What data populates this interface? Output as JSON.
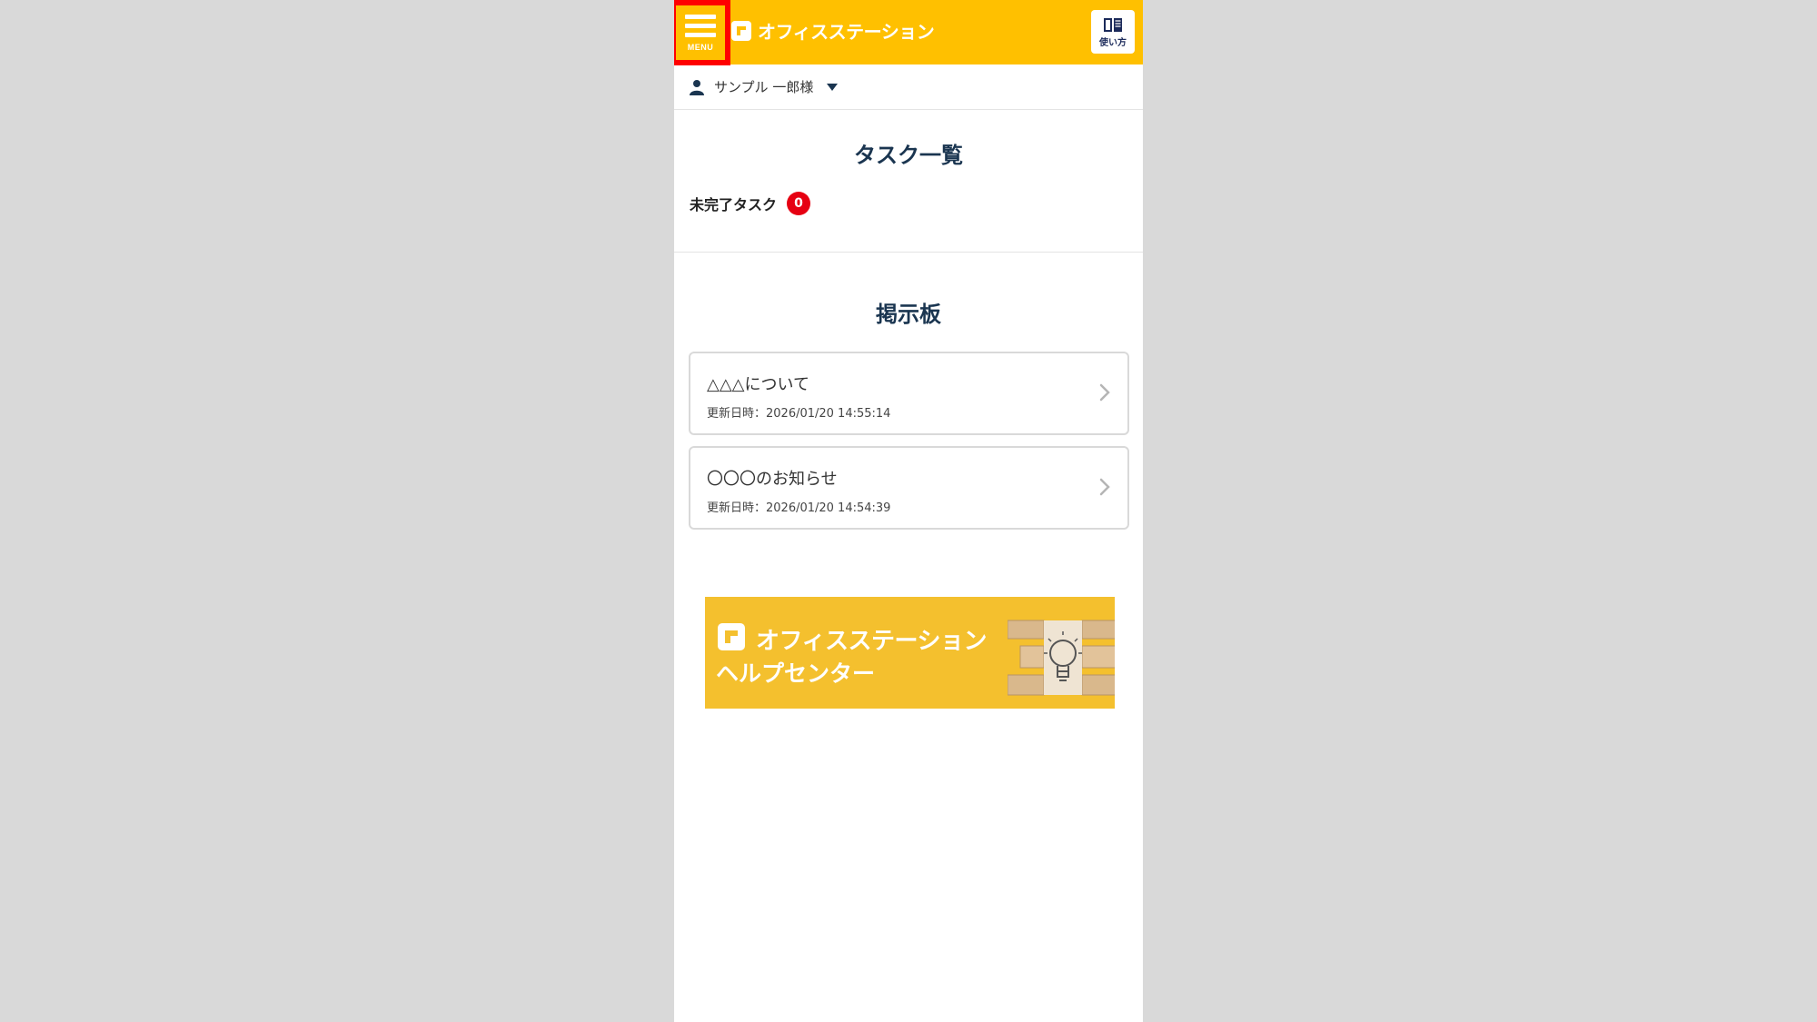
{
  "header": {
    "menu_label": "MENU",
    "logo_text": "オフィスステーション",
    "help_label": "使い方"
  },
  "user": {
    "name": "サンプル 一郎様"
  },
  "tasks": {
    "title": "タスク一覧",
    "incomplete_label": "未完了タスク",
    "incomplete_count": "0"
  },
  "board": {
    "title": "掲示板",
    "items": [
      {
        "title": "△△△について",
        "date": "更新日時：2026/01/20 14:55:14"
      },
      {
        "title": "〇〇〇のお知らせ",
        "date": "更新日時：2026/01/20 14:54:39"
      }
    ]
  },
  "banner": {
    "title": "オフィスステーション",
    "subtitle": "ヘルプセンター"
  },
  "colors": {
    "header_bg": "#ffc000",
    "highlight_border": "#ff0000",
    "badge_bg": "#e60012",
    "heading_text": "#1a3550",
    "banner_bg": "#f4c02e"
  }
}
